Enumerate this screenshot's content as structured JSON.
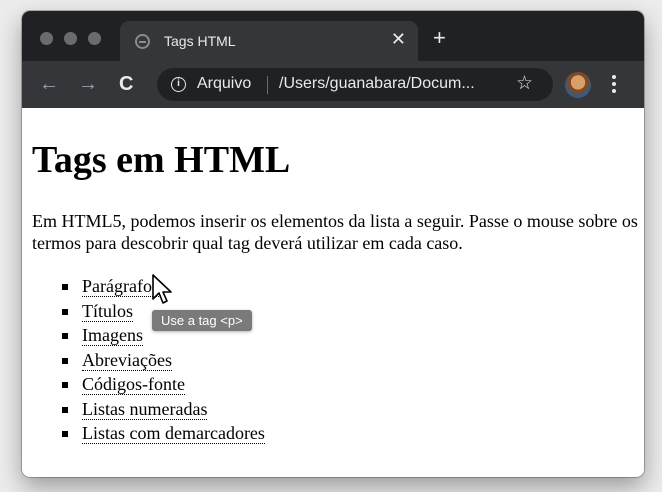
{
  "browser": {
    "tab": {
      "title": "Tags HTML",
      "close_glyph": "✕",
      "favicon": "globe-icon"
    },
    "new_tab_glyph": "+",
    "toolbar": {
      "back_glyph": "←",
      "forward_glyph": "→",
      "reload_glyph": "C",
      "info_glyph": "i",
      "address_scheme": "Arquivo",
      "address_path": "/Users/guanabara/Docum...",
      "star_glyph": "☆"
    }
  },
  "page": {
    "heading": "Tags em HTML",
    "intro": "Em HTML5, podemos inserir os elementos da lista a seguir. Passe o mouse sobre os termos para descobrir qual tag deverá utilizar em cada caso.",
    "items": [
      {
        "label": "Parágrafos"
      },
      {
        "label": "Títulos"
      },
      {
        "label": "Imagens"
      },
      {
        "label": "Abreviações"
      },
      {
        "label": "Códigos-fonte"
      },
      {
        "label": "Listas numeradas"
      },
      {
        "label": "Listas com demarcadores"
      }
    ],
    "tooltip": "Use a tag <p>"
  }
}
